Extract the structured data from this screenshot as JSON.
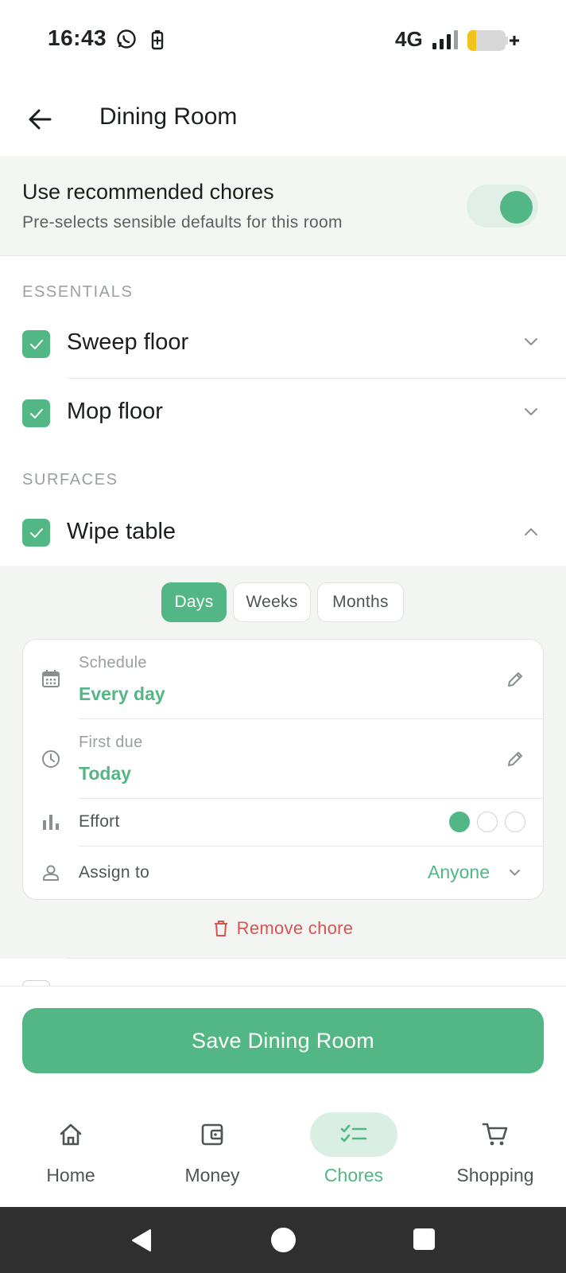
{
  "status_bar": {
    "time": "16:43",
    "network": "4G"
  },
  "header": {
    "title": "Dining Room"
  },
  "recommended": {
    "title": "Use recommended chores",
    "subtitle": "Pre-selects sensible defaults for this room",
    "enabled": true
  },
  "sections": [
    {
      "title": "ESSENTIALS",
      "chores": [
        {
          "label": "Sweep floor",
          "checked": true,
          "expanded": false
        },
        {
          "label": "Mop floor",
          "checked": true,
          "expanded": false
        }
      ]
    },
    {
      "title": "SURFACES",
      "chores": [
        {
          "label": "Wipe table",
          "checked": true,
          "expanded": true
        }
      ]
    }
  ],
  "detail": {
    "period_tabs": [
      "Days",
      "Weeks",
      "Months"
    ],
    "selected_tab": "Days",
    "schedule_label": "Schedule",
    "schedule_value": "Every day",
    "first_due_label": "First due",
    "first_due_value": "Today",
    "effort_label": "Effort",
    "effort_level": 1,
    "effort_max": 3,
    "assign_label": "Assign to",
    "assign_value": "Anyone",
    "remove_label": "Remove chore"
  },
  "save_button": "Save Dining Room",
  "nav": [
    {
      "label": "Home",
      "icon": "home-icon",
      "active": false
    },
    {
      "label": "Money",
      "icon": "wallet-icon",
      "active": false
    },
    {
      "label": "Chores",
      "icon": "checklist-icon",
      "active": true
    },
    {
      "label": "Shopping",
      "icon": "cart-icon",
      "active": false
    }
  ],
  "colors": {
    "accent": "#52b785",
    "danger": "#d9534f",
    "panel": "#f3f7f4"
  }
}
